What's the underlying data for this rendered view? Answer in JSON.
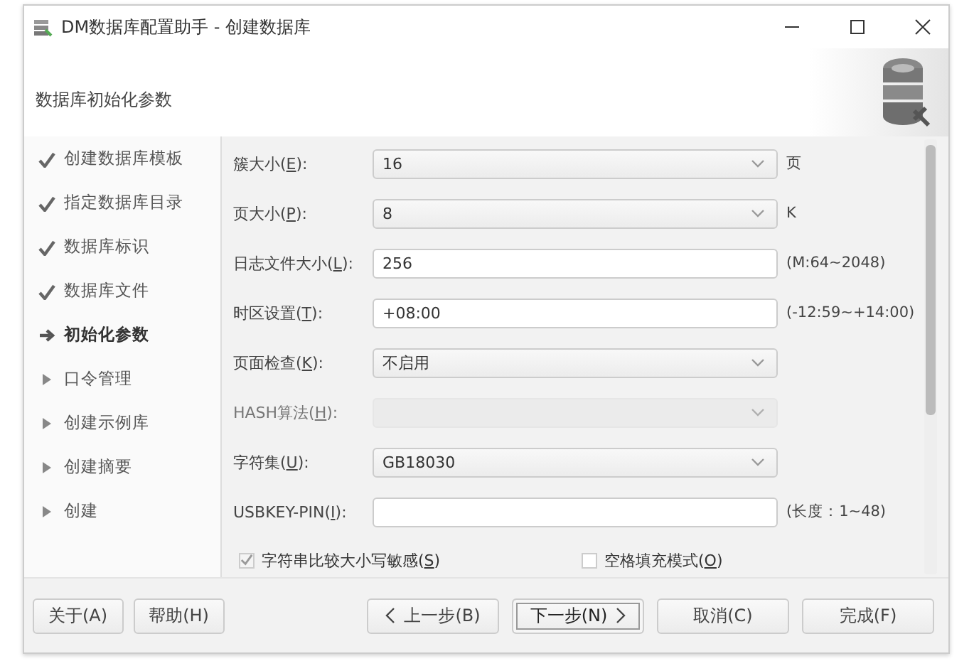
{
  "window": {
    "title": "DM数据库配置助手 - 创建数据库"
  },
  "header": {
    "title": "数据库初始化参数"
  },
  "steps": [
    {
      "label": "创建数据库模板",
      "kind": "done"
    },
    {
      "label": "指定数据库目录",
      "kind": "done"
    },
    {
      "label": "数据库标识",
      "kind": "done"
    },
    {
      "label": "数据库文件",
      "kind": "done"
    },
    {
      "label": "初始化参数",
      "kind": "current"
    },
    {
      "label": "口令管理",
      "kind": "pending"
    },
    {
      "label": "创建示例库",
      "kind": "pending"
    },
    {
      "label": "创建摘要",
      "kind": "pending"
    },
    {
      "label": "创建",
      "kind": "pending"
    }
  ],
  "fields": [
    {
      "label": {
        "before": "簇大小(",
        "key": "E",
        "after": "):"
      },
      "kind": "select",
      "value": "16",
      "disabled": false,
      "unit": "页"
    },
    {
      "label": {
        "before": "页大小(",
        "key": "P",
        "after": "):"
      },
      "kind": "select",
      "value": "8",
      "disabled": false,
      "unit": "K"
    },
    {
      "label": {
        "before": "日志文件大小(",
        "key": "L",
        "after": "):"
      },
      "kind": "input",
      "value": "256",
      "disabled": false,
      "unit": "(M:64~2048)"
    },
    {
      "label": {
        "before": "时区设置(",
        "key": "T",
        "after": "):"
      },
      "kind": "input",
      "value": "+08:00",
      "disabled": false,
      "unit": "(-12:59~+14:00)"
    },
    {
      "label": {
        "before": "页面检查(",
        "key": "K",
        "after": "):"
      },
      "kind": "select",
      "value": "不启用",
      "disabled": false
    },
    {
      "label": {
        "before": "HASH算法(",
        "key": "H",
        "after": "):"
      },
      "kind": "select",
      "disabled": true
    },
    {
      "label": {
        "before": "字符集(",
        "key": "U",
        "after": "):"
      },
      "kind": "select",
      "value": "GB18030",
      "disabled": false
    },
    {
      "label": {
        "before": "USBKEY-PIN(",
        "key": "I",
        "after": "):"
      },
      "kind": "input",
      "disabled": false,
      "unit": "(长度：1~48)"
    }
  ],
  "checkboxes": [
    {
      "label": {
        "before": "字符串比较大小写敏感(",
        "key": "S",
        "after": ")"
      },
      "checked": true
    },
    {
      "label": {
        "before": "空格填充模式(",
        "key": "O",
        "after": ")"
      },
      "checked": false
    }
  ],
  "buttons_left": [
    {
      "label": "关于(A)"
    },
    {
      "label": "帮助(H)"
    }
  ],
  "buttons_right": [
    {
      "label": "上一步(B)",
      "kind": "back"
    },
    {
      "label": "下一步(N)",
      "kind": "next"
    },
    {
      "label": "取消(C)",
      "kind": "plain"
    },
    {
      "label": "完成(F)",
      "kind": "plain"
    }
  ]
}
